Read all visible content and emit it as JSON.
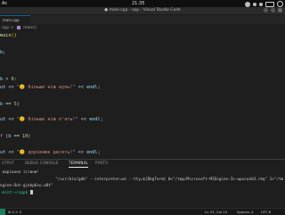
{
  "os_bar": {
    "left_label": "Ac",
    "clock": "21:35"
  },
  "window": {
    "title": "● main.cpp - cpp - Visual Studio Code"
  },
  "tab": {
    "label": "main.cpp"
  },
  "breadcrumb": {
    "file": "cpp",
    "sep": ">",
    "symbol": "main()"
  },
  "editor": {
    "lines": [
      {
        "segs": [
          {
            "c": "fn",
            "t": "main"
          },
          {
            "c": "brace",
            "t": "()"
          }
        ]
      },
      {
        "segs": [
          {
            "c": "plain",
            "t": ""
          }
        ]
      },
      {
        "segs": [
          {
            "c": "var",
            "t": "b"
          },
          {
            "c": "op",
            "t": ";"
          }
        ]
      },
      {
        "segs": [
          {
            "c": "plain",
            "t": ""
          }
        ]
      },
      {
        "segs": [
          {
            "c": "plain",
            "t": ""
          }
        ]
      },
      {
        "segs": [
          {
            "c": "var",
            "t": "b"
          },
          {
            "c": "op",
            "t": " > "
          },
          {
            "c": "num",
            "t": "0"
          },
          {
            "c": "op",
            "t": ":"
          }
        ]
      },
      {
        "segs": [
          {
            "c": "var",
            "t": "ut"
          },
          {
            "c": "op",
            "t": " << "
          },
          {
            "c": "str",
            "t": "\""
          },
          {
            "c": "emoji",
            "t": "😊"
          },
          {
            "c": "str",
            "t": " більше ніж нуль!\""
          },
          {
            "c": "op",
            "t": " << "
          },
          {
            "c": "var",
            "t": "endl"
          },
          {
            "c": "op",
            "t": ";"
          }
        ]
      },
      {
        "segs": [
          {
            "c": "plain",
            "t": ""
          }
        ]
      },
      {
        "segs": [
          {
            "c": "var",
            "t": "b"
          },
          {
            "c": "op",
            "t": " == "
          },
          {
            "c": "num",
            "t": "5"
          },
          {
            "c": "op",
            "t": ")"
          }
        ]
      },
      {
        "segs": [
          {
            "c": "plain",
            "t": ""
          }
        ]
      },
      {
        "segs": [
          {
            "c": "var",
            "t": "ut"
          },
          {
            "c": "op",
            "t": " << "
          },
          {
            "c": "str",
            "t": "\""
          },
          {
            "c": "emoji",
            "t": "😊"
          },
          {
            "c": "str",
            "t": " більше ніж п'ять!\""
          },
          {
            "c": "op",
            "t": " << "
          },
          {
            "c": "var",
            "t": "endl"
          },
          {
            "c": "op",
            "t": ";"
          }
        ]
      },
      {
        "segs": [
          {
            "c": "plain",
            "t": ""
          }
        ]
      },
      {
        "segs": [
          {
            "c": "kw",
            "t": "f"
          },
          {
            "c": "op",
            "t": " ("
          },
          {
            "c": "var",
            "t": "b"
          },
          {
            "c": "op",
            "t": " == "
          },
          {
            "c": "num",
            "t": "10"
          },
          {
            "c": "op",
            "t": ")"
          }
        ]
      },
      {
        "segs": [
          {
            "c": "plain",
            "t": ""
          }
        ]
      },
      {
        "segs": [
          {
            "c": "var",
            "t": "ut"
          },
          {
            "c": "op",
            "t": " << "
          },
          {
            "c": "str",
            "t": "\""
          },
          {
            "c": "emoji",
            "t": "😊"
          },
          {
            "c": "str",
            "t": " дорівнює десять!\""
          },
          {
            "c": "op",
            "t": " << "
          },
          {
            "c": "var",
            "t": "endl"
          },
          {
            "c": "op",
            "t": ";"
          }
        ]
      }
    ]
  },
  "panel": {
    "tabs": [
      "UTPUT",
      "DEBUG CONSOLE",
      "TERMINAL",
      "PORTS"
    ],
    "active_tab": "TERMINAL"
  },
  "terminal": {
    "line1": " варіанне істини!",
    "line2": "                        \"/usr/bin/gdb\" --interpreter=mi --tty=${DbgTerm} 0<\"/tmp/Microsoft-MIEngine-In-wpuco4d3.rbq\" 1>\"/tm",
    "line3": "ngine-Out-gjebp6su.a8t\"",
    "line4": "-mint:~/cpp$ "
  },
  "status_bar": {
    "left": "⊗ 0 ⚠ 0",
    "position": "Ln 23, Col 13",
    "spaces": "Spaces: 4",
    "encoding": "UTF-8"
  }
}
